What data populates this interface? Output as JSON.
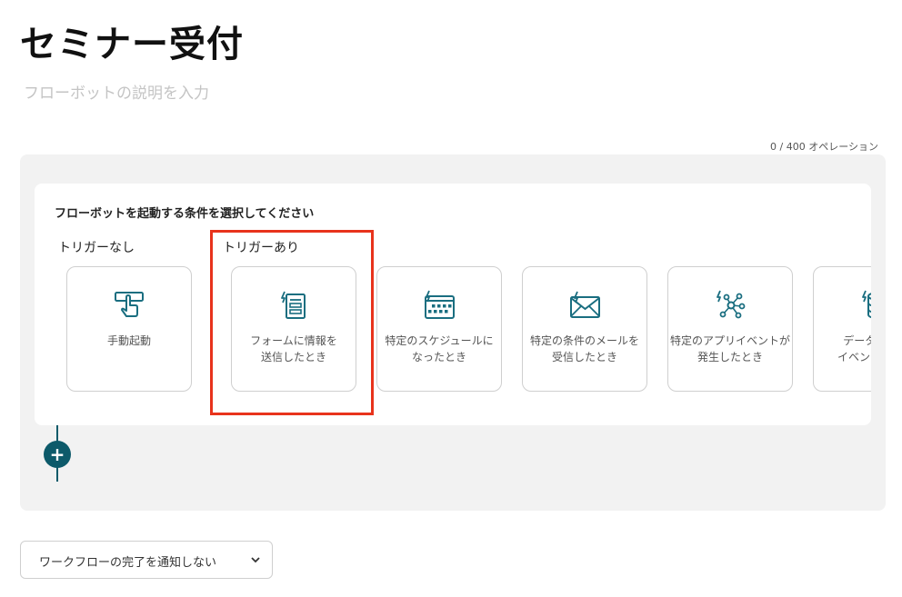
{
  "page": {
    "title": "セミナー受付",
    "description_placeholder": "フローボットの説明を入力",
    "operations": "0 / 400 オペレーション"
  },
  "trigger_card": {
    "heading": "フローボットを起動する条件を選択してください",
    "group_no_trigger": "トリガーなし",
    "group_with_trigger": "トリガーあり",
    "tiles": [
      {
        "label": "手動起動",
        "icon": "manual-press-icon"
      },
      {
        "label": "フォームに情報を\n送信したとき",
        "icon": "form-icon"
      },
      {
        "label": "特定のスケジュールに\nなったとき",
        "icon": "calendar-icon"
      },
      {
        "label": "特定の条件のメールを\n受信したとき",
        "icon": "mail-icon"
      },
      {
        "label": "特定のアプリイベントが\n発生したとき",
        "icon": "app-event-icon"
      },
      {
        "label": "データベース\nイベントが発生",
        "icon": "database-icon"
      }
    ]
  },
  "add_step": {
    "symbol": "+"
  },
  "notification": {
    "selected": "ワークフローの完了を通知しない"
  },
  "colors": {
    "accent": "#0d5a6a",
    "highlight": "#e8331c",
    "canvas_bg": "#f2f2f2",
    "icon": "#1a6e80"
  }
}
